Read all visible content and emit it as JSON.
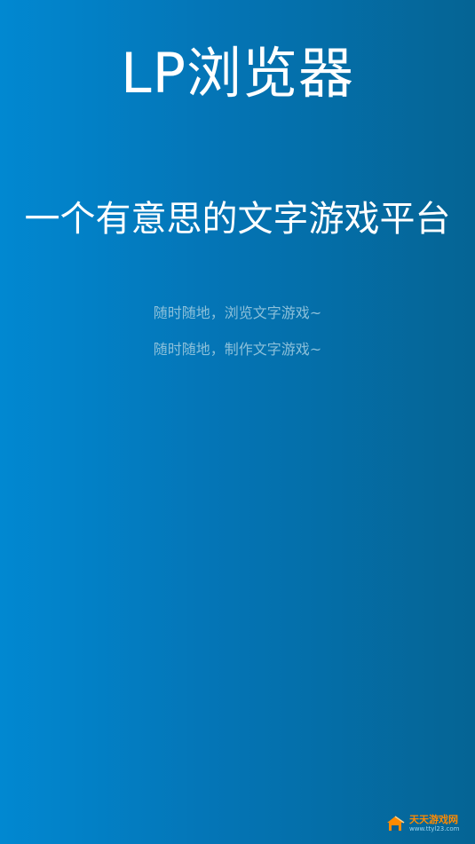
{
  "app": {
    "title": "LP浏览器",
    "tagline": "一个有意思的文字游戏平台",
    "lines": [
      "随时随地，浏览文字游戏~",
      "随时随地，制作文字游戏~"
    ]
  },
  "watermark": {
    "title": "天天游戏网",
    "url": "www.ttyl23.com",
    "icon": "house-logo-icon"
  },
  "colors": {
    "background_left": "#0188d1",
    "background_right": "#056494",
    "title_text": "#ffffff",
    "subtitle_text": "#8cc0da",
    "watermark_text": "#ff8a00"
  }
}
